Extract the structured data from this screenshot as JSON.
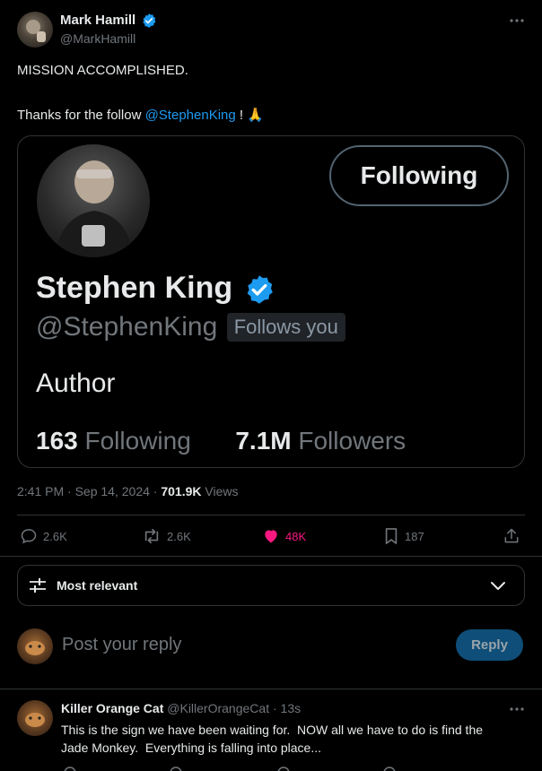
{
  "post": {
    "author_name": "Mark Hamill",
    "author_handle": "@MarkHamill",
    "text_line1": "MISSION ACCOMPLISHED.",
    "text_line2_prefix": "Thanks for the follow ",
    "mention": "@StephenKing",
    "text_line2_suffix": " ! ",
    "emoji": "🙏",
    "time": "2:41 PM",
    "date": "Sep 14, 2024",
    "views_count": "701.9K",
    "views_label": "Views"
  },
  "card": {
    "name": "Stephen King",
    "handle": "@StephenKing",
    "follows_you": "Follows you",
    "following_button": "Following",
    "bio": "Author",
    "following_count": "163",
    "following_label": "Following",
    "followers_count": "7.1M",
    "followers_label": "Followers"
  },
  "actions": {
    "replies": "2.6K",
    "reposts": "2.6K",
    "likes": "48K",
    "bookmarks": "187"
  },
  "sort": {
    "label": "Most relevant"
  },
  "composer": {
    "placeholder": "Post your reply",
    "reply_button": "Reply"
  },
  "reply": {
    "author_name": "Killer Orange Cat",
    "author_handle": "@KillerOrangeCat",
    "time": "13s",
    "text_line1": "This is the sign we have been waiting for.  NOW all we have to do is find the",
    "text_line2": "Jade Monkey.  Everything is falling into place..."
  },
  "colors": {
    "accent": "#1d9bf0",
    "like": "#f91880",
    "muted": "#71767b",
    "border": "#2f3336"
  }
}
